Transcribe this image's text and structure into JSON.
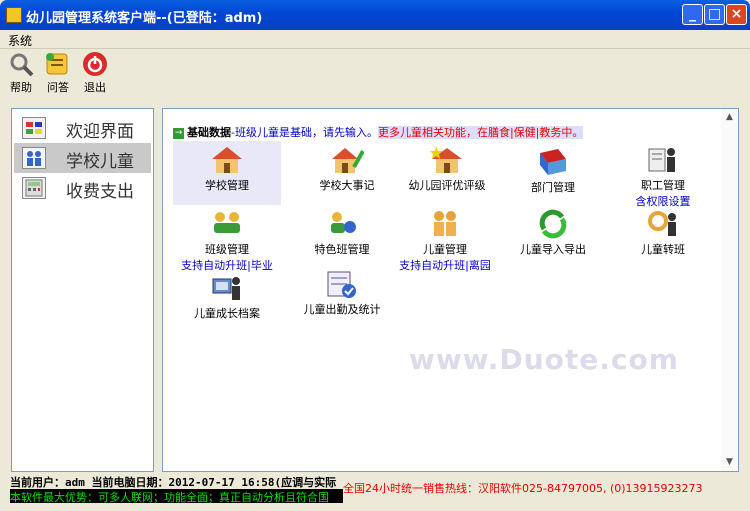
{
  "window": {
    "title": "幼儿园管理系统客户端--(已登陆：adm)"
  },
  "menu": {
    "system": "系统"
  },
  "toolbar": {
    "help": "帮助",
    "faq": "问答",
    "exit": "退出"
  },
  "nav": [
    {
      "label": "欢迎界面"
    },
    {
      "label": "学校儿童",
      "selected": true
    },
    {
      "label": "收费支出"
    }
  ],
  "main": {
    "headline": {
      "label": "基础数据",
      "note": "-班级儿童是基础，请先输入。",
      "more": "更多儿童相关功能，在膳食|保健|教务中。"
    },
    "items": [
      {
        "label": "学校管理"
      },
      {
        "label": "学校大事记"
      },
      {
        "label": "幼儿园评优评级"
      },
      {
        "label": "部门管理"
      },
      {
        "label": "职工管理",
        "sub": "含权限设置"
      },
      {
        "label": "班级管理",
        "sub": "支持自动升班|毕业"
      },
      {
        "label": "特色班管理"
      },
      {
        "label": "儿童管理",
        "sub": "支持自动升班|离园"
      },
      {
        "label": "儿童导入导出"
      },
      {
        "label": "儿童转班"
      },
      {
        "label": "儿童成长档案"
      },
      {
        "label": "儿童出勤及统计"
      }
    ]
  },
  "status": {
    "user_line": "当前用户：adm 当前电脑日期：2012-07-17  16:58(应调与实际",
    "advantage": "本软件最大优势：可多人联网；功能全面；真正自动分析且符合国",
    "hotline": "全国24小时统一销售热线：汉阳软件025-84797005, (0)13915923273"
  },
  "watermark": "www.Duote.com",
  "colors": {
    "title_bar": "#0047d6",
    "selected_nav": "#c9c9c9",
    "link_blue": "#0000cc",
    "hotline_red": "#e00000"
  }
}
